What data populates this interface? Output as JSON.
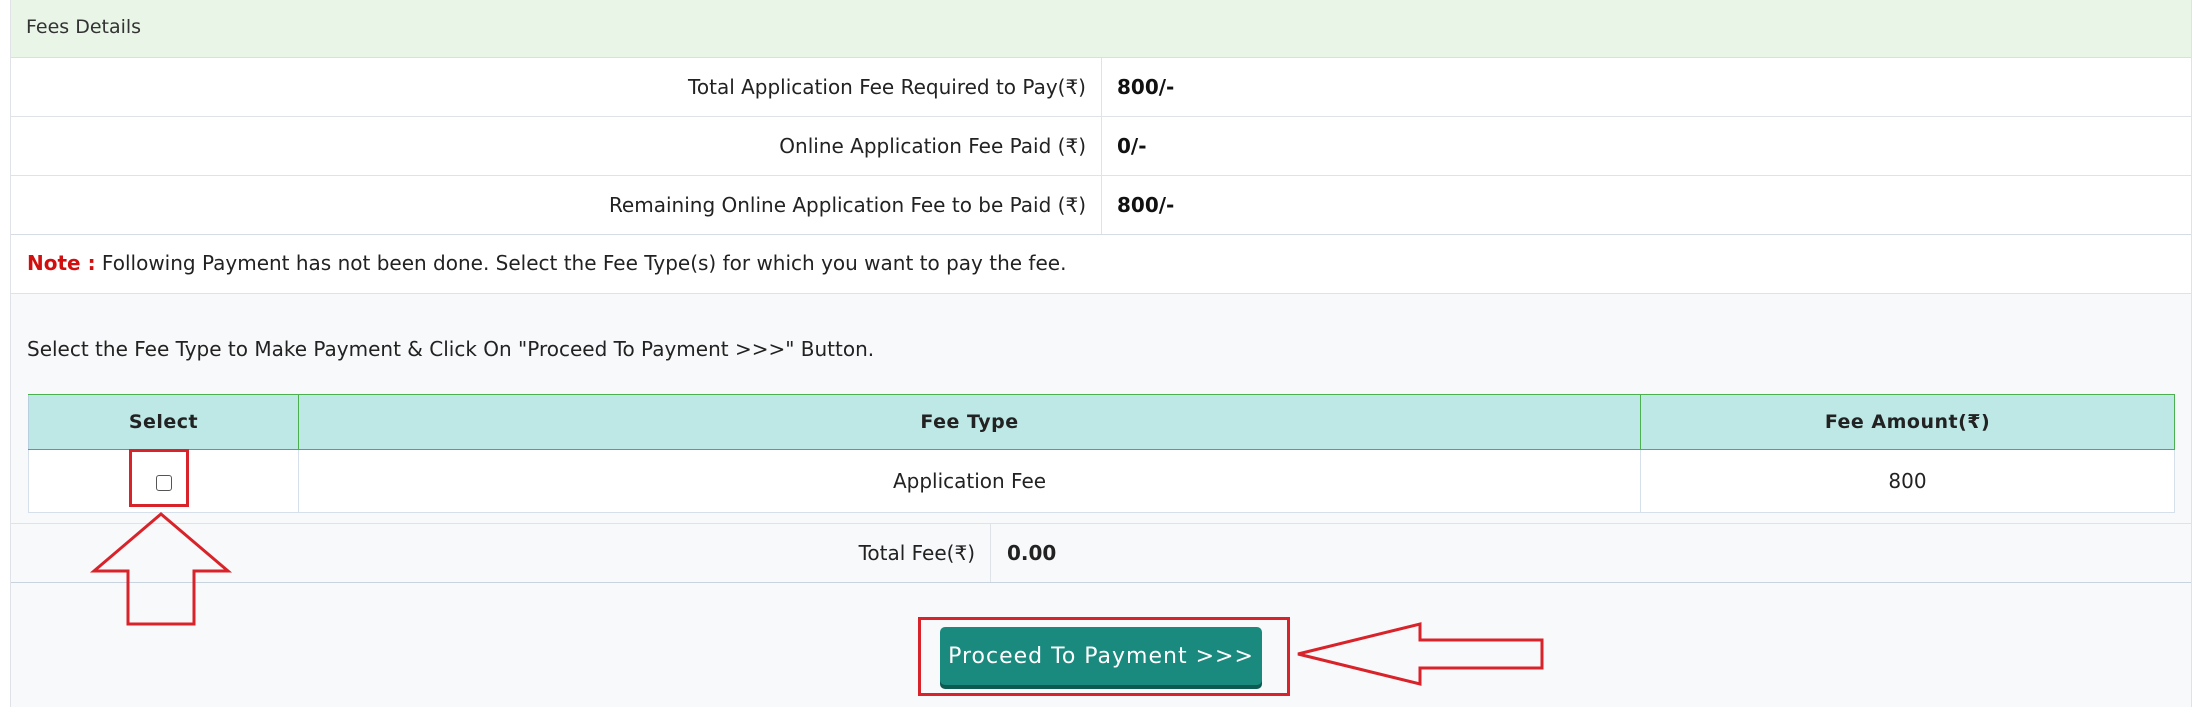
{
  "panel": {
    "title": "Fees Details"
  },
  "summary": [
    {
      "label": "Total Application Fee Required to Pay(₹)",
      "value": "800/-"
    },
    {
      "label": "Online Application Fee Paid (₹)",
      "value": "0/-"
    },
    {
      "label": "Remaining Online Application Fee to be Paid (₹)",
      "value": "800/-"
    }
  ],
  "note": {
    "label": "Note :",
    "text": " Following Payment has not been done. Select the Fee Type(s) for which you want to pay the fee."
  },
  "instruction": "Select the Fee Type to Make Payment & Click On \"Proceed To Payment >>>\" Button.",
  "fee_table": {
    "headers": [
      "Select",
      "Fee Type",
      "Fee Amount(₹)"
    ],
    "rows": [
      {
        "fee_type": "Application Fee",
        "amount": "800",
        "selected": false
      }
    ]
  },
  "total": {
    "label": "Total Fee(₹)",
    "value": "0.00"
  },
  "proceed_button": {
    "label": "Proceed To Payment >>>"
  },
  "colors": {
    "accent": "#1a8a7f",
    "annotation": "#d8232a",
    "note": "#d10f0f",
    "header_bg": "#bde8e6"
  }
}
